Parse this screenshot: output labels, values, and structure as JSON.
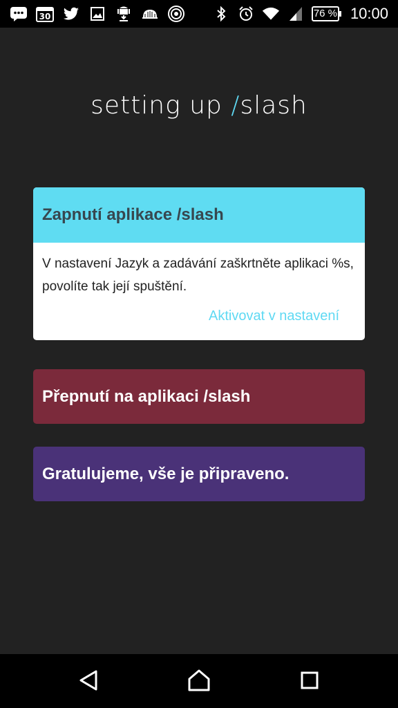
{
  "status_bar": {
    "notification_icons": [
      "message-icon",
      "calendar-icon",
      "twitter-icon",
      "image-icon",
      "android-download-icon",
      "cloud-icon",
      "radar-icon"
    ],
    "calendar_day": "30",
    "system_icons": [
      "bluetooth-icon",
      "alarm-icon",
      "wifi-icon",
      "signal-icon"
    ],
    "battery": "76 %",
    "time": "10:00"
  },
  "header": {
    "title_prefix": "setting up ",
    "title_slash": "/",
    "title_suffix": "slash"
  },
  "steps": [
    {
      "title": "Zapnutí aplikace /slash",
      "description": "V nastavení Jazyk a zadávání zaškrtněte aplikaci %s, povolíte tak její spuštění.",
      "action": "Aktivovat v nastavení",
      "color": "#5fdcf2"
    },
    {
      "title": "Přepnutí na aplikaci /slash",
      "color": "#7b2a3b"
    },
    {
      "title": "Gratulujeme, vše je připraveno.",
      "color": "#4a3278"
    }
  ],
  "nav_bar": {
    "buttons": [
      "back-icon",
      "home-icon",
      "recents-icon"
    ]
  }
}
